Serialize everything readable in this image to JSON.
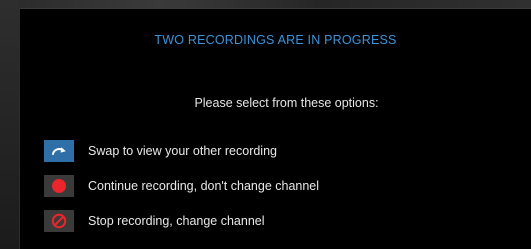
{
  "dialog": {
    "title": "TWO RECORDINGS ARE IN PROGRESS",
    "prompt": "Please select from these options:"
  },
  "options": [
    {
      "label": "Swap to view your other recording",
      "icon": "swap-arrow-icon",
      "selected": true
    },
    {
      "label": "Continue recording, don't change channel",
      "icon": "record-dot-icon",
      "selected": false
    },
    {
      "label": "Stop recording, change channel",
      "icon": "no-entry-icon",
      "selected": false
    }
  ],
  "colors": {
    "title": "#3d93d8",
    "selected_icon_bg": "#2f6fa8",
    "icon_bg": "#3a3a3a",
    "record_red": "#e8262b",
    "text": "#e8e8e8"
  }
}
